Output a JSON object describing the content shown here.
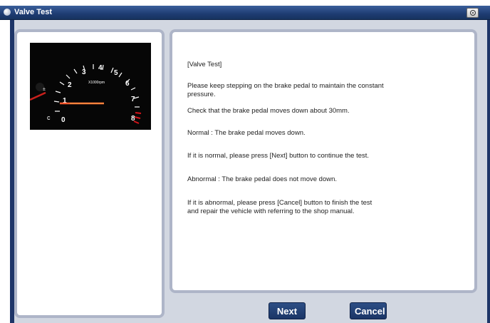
{
  "window": {
    "title": "Valve Test"
  },
  "gauge": {
    "ticks": [
      "0",
      "1",
      "2",
      "3",
      "4",
      "5",
      "6",
      "7",
      "8"
    ],
    "unit": "X1000rpm"
  },
  "message": {
    "paragraphs": [
      "[Valve Test]",
      "Please keep stepping on the brake pedal to maintain the constant\npressure.",
      "Check that the brake pedal moves down about 30mm.",
      " Normal : The brake pedal moves down.",
      "If it is normal, please press [Next] button to continue the test.",
      " Abnormal : The brake pedal does not move down.",
      "If it is abnormal, please press [Cancel] button to finish the test\nand repair the vehicle with referring to the shop manual."
    ]
  },
  "buttons": {
    "next": "Next",
    "cancel": "Cancel"
  }
}
